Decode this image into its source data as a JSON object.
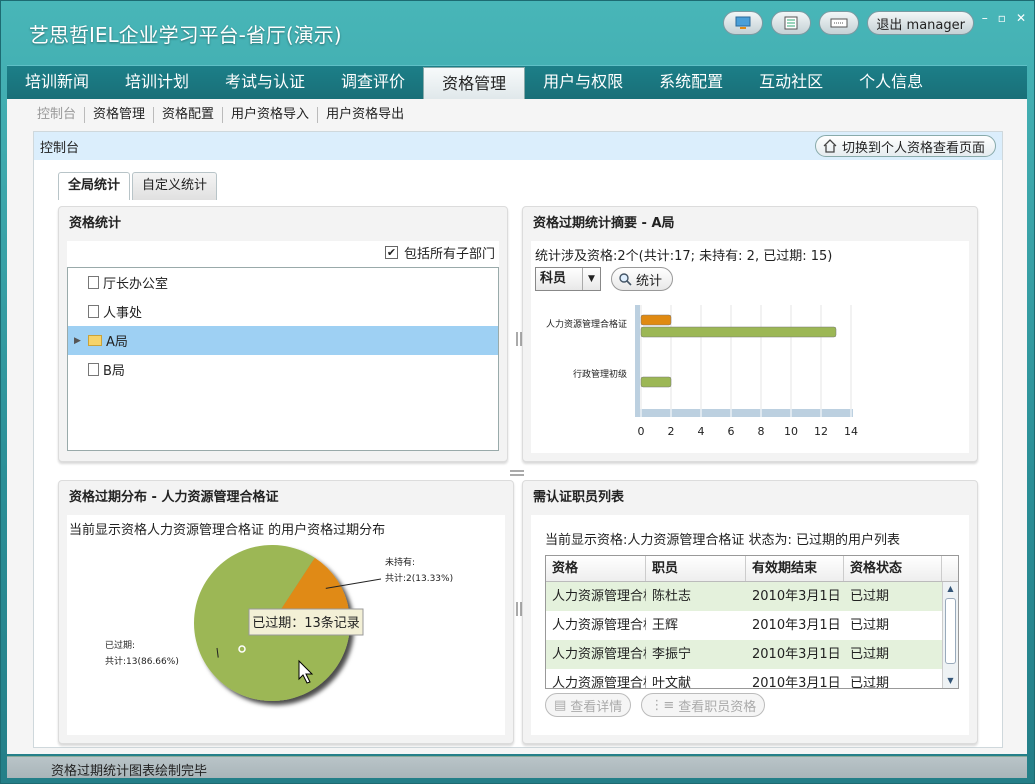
{
  "app": {
    "title": "艺思哲IEL企业学习平台-省厅(演示)",
    "logout_label": "退出 manager"
  },
  "nav": {
    "items": [
      "培训新闻",
      "培训计划",
      "考试与认证",
      "调查评价",
      "资格管理",
      "用户与权限",
      "系统配置",
      "互动社区",
      "个人信息"
    ],
    "active_index": 4
  },
  "subnav": {
    "items": [
      "控制台",
      "资格管理",
      "资格配置",
      "用户资格导入",
      "用户资格导出"
    ]
  },
  "console": {
    "title": "控制台",
    "switch_label": "切换到个人资格查看页面"
  },
  "tabs": [
    "全局统计",
    "自定义统计"
  ],
  "qual_stats": {
    "title": "资格统计",
    "include_children_label": "包括所有子部门",
    "include_children": true,
    "tree": [
      {
        "label": "厅长办公室",
        "icon": "document-icon"
      },
      {
        "label": "人事处",
        "icon": "document-icon"
      },
      {
        "label": "A局",
        "icon": "folder-icon",
        "selected": true
      },
      {
        "label": "B局",
        "icon": "document-icon"
      }
    ]
  },
  "expiry_summary": {
    "title": "资格过期统计摘要 - A局",
    "summary": "统计涉及资格:2个(共计:17; 未持有: 2, 已过期: 15)",
    "select_value": "科员",
    "stat_button": "统计"
  },
  "chart_data": [
    {
      "type": "bar",
      "orientation": "horizontal",
      "categories": [
        "人力资源管理合格证",
        "行政管理初级"
      ],
      "series": [
        {
          "values": [
            2,
            0
          ],
          "color": "#e08a12"
        },
        {
          "values": [
            13,
            2
          ],
          "color": "#9cb755"
        }
      ],
      "xlim": [
        0,
        14
      ],
      "xticks": [
        "0",
        "2",
        "4",
        "6",
        "8",
        "10",
        "12",
        "14"
      ]
    },
    {
      "type": "pie",
      "title": "资格过期分布 - 人力资源管理合格证",
      "subtitle": "当前显示资格人力资源管理合格证 的用户资格过期分布",
      "slices": [
        {
          "label": "未持有:",
          "detail": "共计:2(13.33%)",
          "value": 2,
          "color": "#e08a12"
        },
        {
          "label": "已过期:",
          "detail": "共计:13(86.66%)",
          "value": 13,
          "color": "#9cb755"
        }
      ],
      "tooltip": "已过期：13条记录"
    }
  ],
  "employee_list": {
    "title": "需认证职员列表",
    "subtitle": "当前显示资格:人力资源管理合格证 状态为: 已过期的用户列表",
    "columns": [
      "资格",
      "职员",
      "有效期结束",
      "资格状态"
    ],
    "rows": [
      [
        "人力资源管理合格证",
        "陈杜志",
        "2010年3月1日",
        "已过期"
      ],
      [
        "人力资源管理合格证",
        "王辉",
        "2010年3月1日",
        "已过期"
      ],
      [
        "人力资源管理合格证",
        "李振宁",
        "2010年3月1日",
        "已过期"
      ],
      [
        "人力资源管理合格证",
        "叶文献",
        "2010年3月1日",
        "已过期"
      ]
    ],
    "view_detail_label": "查看详情",
    "view_employee_label": "查看职员资格"
  },
  "status": {
    "text": "资格过期统计图表绘制完毕"
  }
}
